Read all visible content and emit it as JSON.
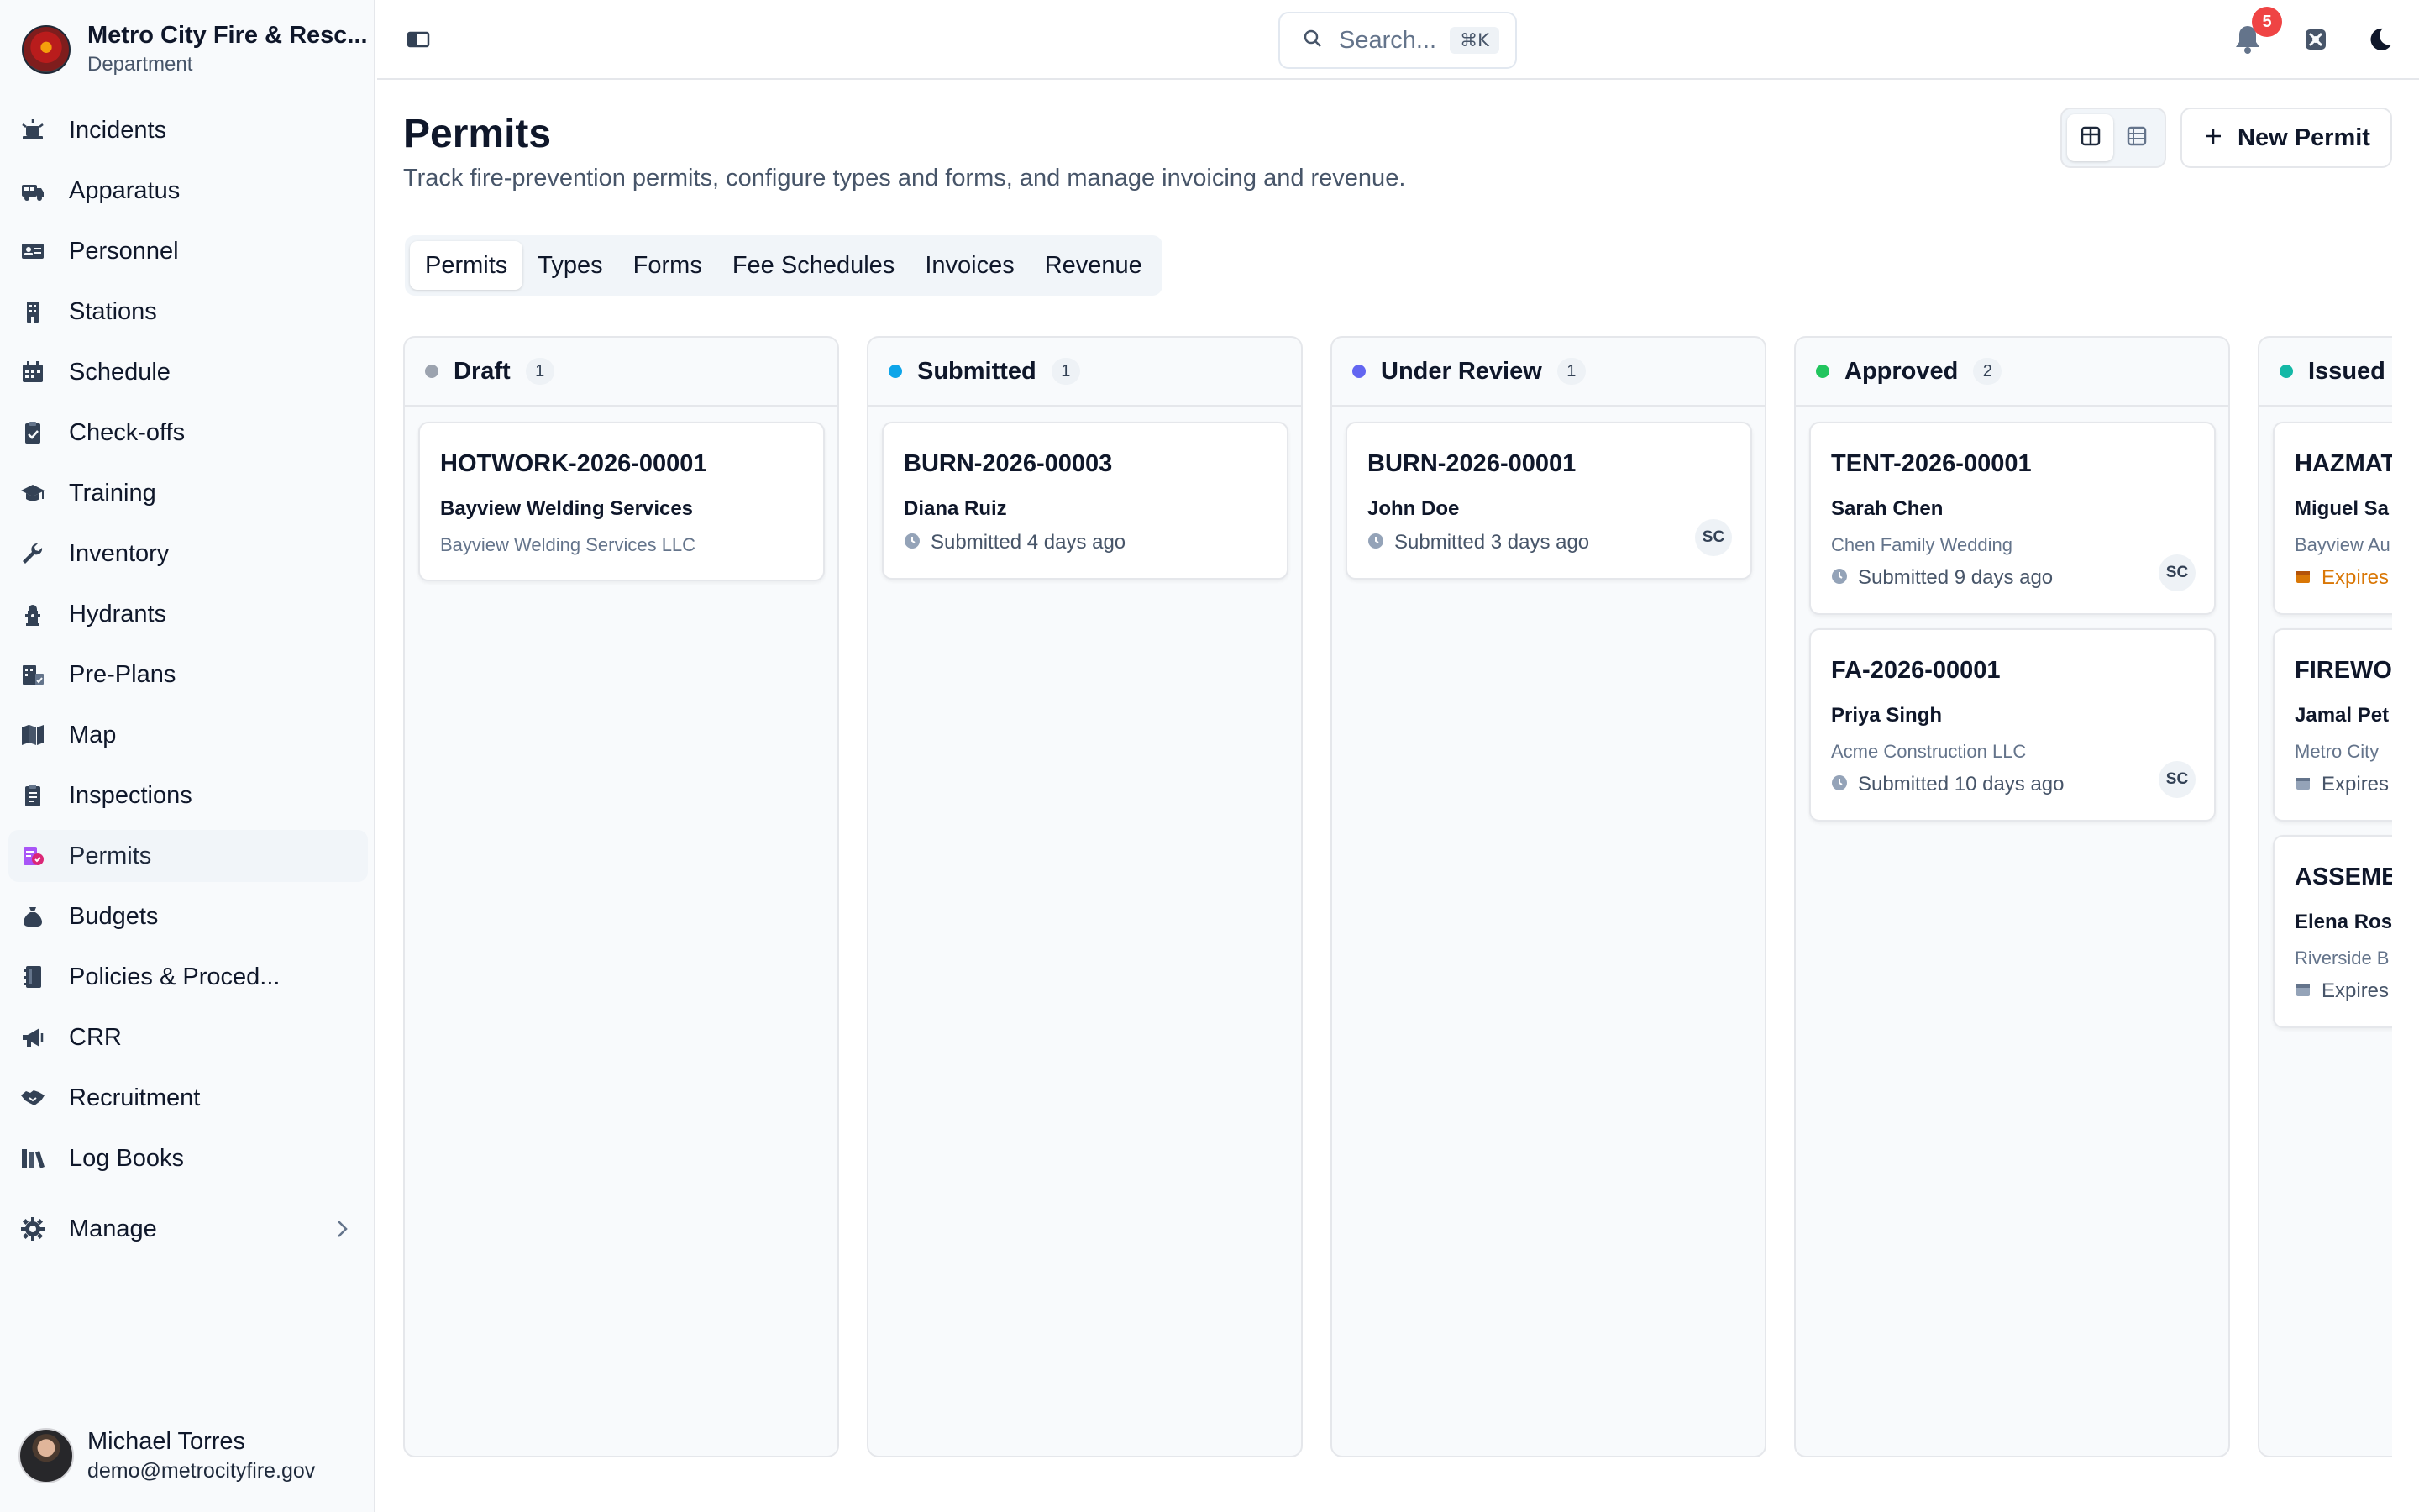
{
  "org": {
    "name": "Metro City Fire & Resc...",
    "subtitle": "Department"
  },
  "sidebar": {
    "items": [
      {
        "label": "Incidents",
        "icon": "siren-icon"
      },
      {
        "label": "Apparatus",
        "icon": "fire-truck-icon"
      },
      {
        "label": "Personnel",
        "icon": "id-card-icon"
      },
      {
        "label": "Stations",
        "icon": "building-icon"
      },
      {
        "label": "Schedule",
        "icon": "calendar-icon"
      },
      {
        "label": "Check-offs",
        "icon": "clipboard-check-icon"
      },
      {
        "label": "Training",
        "icon": "graduation-cap-icon"
      },
      {
        "label": "Inventory",
        "icon": "wrench-icon"
      },
      {
        "label": "Hydrants",
        "icon": "hydrant-icon"
      },
      {
        "label": "Pre-Plans",
        "icon": "building-plan-icon"
      },
      {
        "label": "Map",
        "icon": "map-icon"
      },
      {
        "label": "Inspections",
        "icon": "clipboard-list-icon"
      },
      {
        "label": "Permits",
        "icon": "permit-icon",
        "active": true
      },
      {
        "label": "Budgets",
        "icon": "money-bag-icon"
      },
      {
        "label": "Policies & Proced...",
        "icon": "binder-icon"
      },
      {
        "label": "CRR",
        "icon": "megaphone-icon"
      },
      {
        "label": "Recruitment",
        "icon": "handshake-icon"
      },
      {
        "label": "Log Books",
        "icon": "books-icon"
      }
    ],
    "manage_label": "Manage"
  },
  "user": {
    "name": "Michael Torres",
    "email": "demo@metrocityfire.gov"
  },
  "topbar": {
    "search_placeholder": "Search...",
    "search_shortcut": "⌘K",
    "notification_count": "5"
  },
  "page": {
    "title": "Permits",
    "subtitle": "Track fire-prevention permits, configure types and forms, and manage invoicing and revenue.",
    "new_button": "New Permit"
  },
  "tabs": [
    "Permits",
    "Types",
    "Forms",
    "Fee Schedules",
    "Invoices",
    "Revenue"
  ],
  "active_tab": "Permits",
  "colors": {
    "draft": "#9ca3af",
    "submitted": "#0ea5e9",
    "under_review": "#6366f1",
    "approved": "#22c55e",
    "issued": "#14b8a6",
    "warning": "#d97706",
    "notification": "#ef4444"
  },
  "board": {
    "columns": [
      {
        "title": "Draft",
        "count": "1",
        "cards": [
          {
            "id": "HOTWORK-2026-00001",
            "name": "Bayview Welding Services",
            "org": "Bayview Welding Services LLC"
          }
        ]
      },
      {
        "title": "Submitted",
        "count": "1",
        "cards": [
          {
            "id": "BURN-2026-00003",
            "name": "Diana Ruiz",
            "meta": "Submitted 4 days ago"
          }
        ]
      },
      {
        "title": "Under Review",
        "count": "1",
        "cards": [
          {
            "id": "BURN-2026-00001",
            "name": "John Doe",
            "meta": "Submitted 3 days ago",
            "assignee": "SC"
          }
        ]
      },
      {
        "title": "Approved",
        "count": "2",
        "cards": [
          {
            "id": "TENT-2026-00001",
            "name": "Sarah Chen",
            "org": "Chen Family Wedding",
            "meta": "Submitted 9 days ago",
            "assignee": "SC"
          },
          {
            "id": "FA-2026-00001",
            "name": "Priya Singh",
            "org": "Acme Construction LLC",
            "meta": "Submitted 10 days ago",
            "assignee": "SC"
          }
        ]
      },
      {
        "title": "Issued",
        "count": "",
        "cards": [
          {
            "id": "HAZMAT",
            "name": "Miguel Sa",
            "org": "Bayview Au",
            "meta": "Expires"
          },
          {
            "id": "FIREWOR",
            "name": "Jamal Pet",
            "org": "Metro City",
            "meta": "Expires"
          },
          {
            "id": "ASSEMB",
            "name": "Elena Ros",
            "org": "Riverside B",
            "meta": "Expires"
          }
        ]
      }
    ]
  }
}
